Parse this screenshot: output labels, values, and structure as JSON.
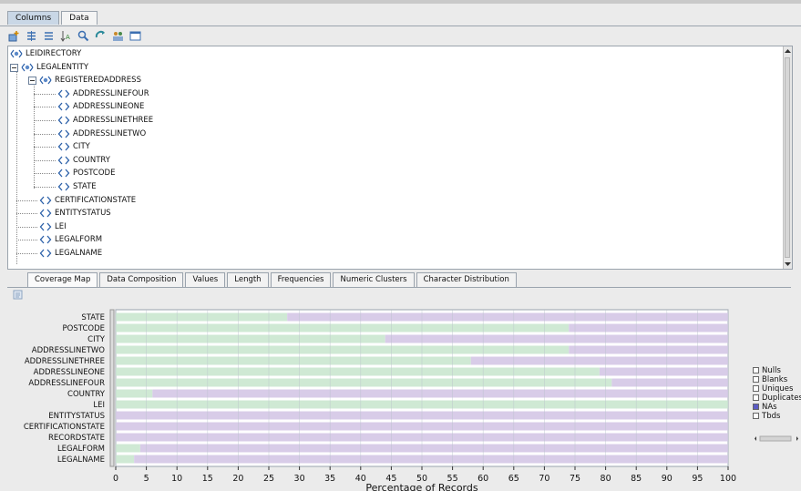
{
  "tabs": [
    {
      "label": "Columns"
    },
    {
      "label": "Data"
    }
  ],
  "toolbar": {
    "icons": [
      "add-column-icon",
      "expand-all-icon",
      "collapse-all-icon",
      "sort-icon",
      "search-icon",
      "refresh-icon",
      "users-icon",
      "window-icon"
    ]
  },
  "tree": {
    "rows": [
      {
        "label": "LEIDIRECTORY",
        "type": "element"
      },
      {
        "label": "LEGALENTITY",
        "type": "element"
      },
      {
        "label": "REGISTEREDADDRESS",
        "type": "element"
      },
      {
        "label": "ADDRESSLINEFOUR",
        "type": "field"
      },
      {
        "label": "ADDRESSLINEONE",
        "type": "field"
      },
      {
        "label": "ADDRESSLINETHREE",
        "type": "field"
      },
      {
        "label": "ADDRESSLINETWO",
        "type": "field"
      },
      {
        "label": "CITY",
        "type": "field"
      },
      {
        "label": "COUNTRY",
        "type": "field"
      },
      {
        "label": "POSTCODE",
        "type": "field"
      },
      {
        "label": "STATE",
        "type": "field"
      },
      {
        "label": "CERTIFICATIONSTATE",
        "type": "field"
      },
      {
        "label": "ENTITYSTATUS",
        "type": "field"
      },
      {
        "label": "LEI",
        "type": "field"
      },
      {
        "label": "LEGALFORM",
        "type": "field"
      },
      {
        "label": "LEGALNAME",
        "type": "field"
      }
    ]
  },
  "subtabs": [
    {
      "label": "Coverage Map"
    },
    {
      "label": "Data Composition"
    },
    {
      "label": "Values"
    },
    {
      "label": "Length"
    },
    {
      "label": "Frequencies"
    },
    {
      "label": "Numeric Clusters"
    },
    {
      "label": "Character Distribution"
    }
  ],
  "legend": {
    "items": [
      {
        "label": "Nulls"
      },
      {
        "label": "Blanks"
      },
      {
        "label": "Uniques"
      },
      {
        "label": "Duplicates"
      },
      {
        "label": "NAs"
      },
      {
        "label": "Tbds"
      }
    ]
  },
  "colors": {
    "uniques": "#cfe9d4",
    "duplicates": "#d8cce8",
    "nas": "#5b5bc4"
  },
  "chart_data": {
    "type": "bar",
    "orientation": "horizontal",
    "stacked": true,
    "categories": [
      "STATE",
      "POSTCODE",
      "CITY",
      "ADDRESSLINETWO",
      "ADDRESSLINETHREE",
      "ADDRESSLINEONE",
      "ADDRESSLINEFOUR",
      "COUNTRY",
      "LEI",
      "ENTITYSTATUS",
      "CERTIFICATIONSTATE",
      "RECORDSTATE",
      "LEGALFORM",
      "LEGALNAME"
    ],
    "series": [
      {
        "name": "Uniques",
        "values": [
          28,
          74,
          44,
          74,
          58,
          79,
          81,
          6,
          100,
          0,
          0,
          0,
          4,
          3
        ]
      },
      {
        "name": "Duplicates",
        "values": [
          72,
          26,
          56,
          26,
          42,
          21,
          19,
          94,
          0,
          100,
          100,
          100,
          96,
          97
        ]
      }
    ],
    "xlabel": "Percentage of Records",
    "xlim": [
      0,
      100
    ],
    "xticks": [
      0,
      5,
      10,
      15,
      20,
      25,
      30,
      35,
      40,
      45,
      50,
      55,
      60,
      65,
      70,
      75,
      80,
      85,
      90,
      95,
      100
    ],
    "grid": true,
    "legend": "right"
  }
}
